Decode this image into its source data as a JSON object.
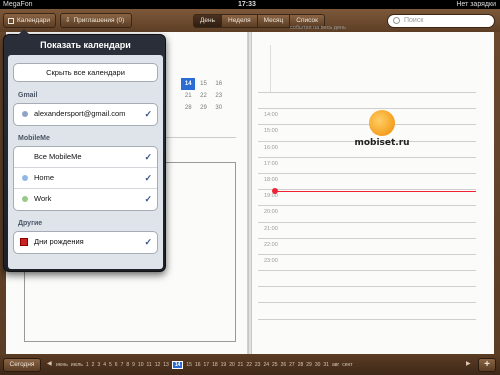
{
  "statusbar": {
    "carrier": "MegaFon",
    "time": "17:33",
    "battery": "Нет зарядки"
  },
  "toolbar": {
    "calendars_label": "Календари",
    "invitations_label": "Приглашения (0)",
    "segments": [
      "День",
      "Неделя",
      "Месяц",
      "Список"
    ],
    "active_segment": "День",
    "search_placeholder": "Поиск"
  },
  "mini_calendar": {
    "rows": [
      [
        "",
        "",
        "",
        "",
        ""
      ],
      [
        "",
        "",
        "",
        "",
        ""
      ],
      [
        "",
        "14",
        "15",
        "16",
        ""
      ],
      [
        "",
        "21",
        "22",
        "23",
        ""
      ],
      [
        "",
        "28",
        "29",
        "30",
        ""
      ]
    ],
    "today": "14"
  },
  "day_view": {
    "allday_label": "события на весь день",
    "hours": [
      "",
      "14:00",
      "15:00",
      "16:00",
      "17:00",
      "18:00",
      "19:00",
      "20:00",
      "21:00",
      "22:00",
      "23:00",
      "",
      "",
      "",
      ""
    ]
  },
  "watermark": {
    "text": "mobiset.ru"
  },
  "popover": {
    "title": "Показать календари",
    "hide_all": "Скрыть все календари",
    "sections": [
      {
        "label": "Gmail",
        "items": [
          {
            "label": "alexandersport@gmail.com",
            "color": "#8fa3c7",
            "checked": true
          }
        ]
      },
      {
        "label": "MobileMe",
        "items": [
          {
            "label": "Все MobileMe",
            "color": "",
            "checked": true
          },
          {
            "label": "Home",
            "color": "#8fb7e8",
            "checked": true
          },
          {
            "label": "Work",
            "color": "#98c98a",
            "checked": true
          }
        ]
      },
      {
        "label": "Другие",
        "items": [
          {
            "label": "Дни рождения",
            "color": "#cc2222",
            "checked": true
          }
        ]
      }
    ]
  },
  "bottombar": {
    "today_label": "Сегодня",
    "add_label": "+",
    "timeline": [
      "июнь",
      "июль",
      "1",
      "2",
      "3",
      "4",
      "5",
      "6",
      "7",
      "8",
      "9",
      "10",
      "11",
      "12",
      "13",
      "14",
      "15",
      "16",
      "17",
      "18",
      "19",
      "20",
      "21",
      "22",
      "23",
      "24",
      "25",
      "26",
      "27",
      "28",
      "29",
      "30",
      "31",
      "авг",
      "сент"
    ],
    "selected": "14"
  }
}
